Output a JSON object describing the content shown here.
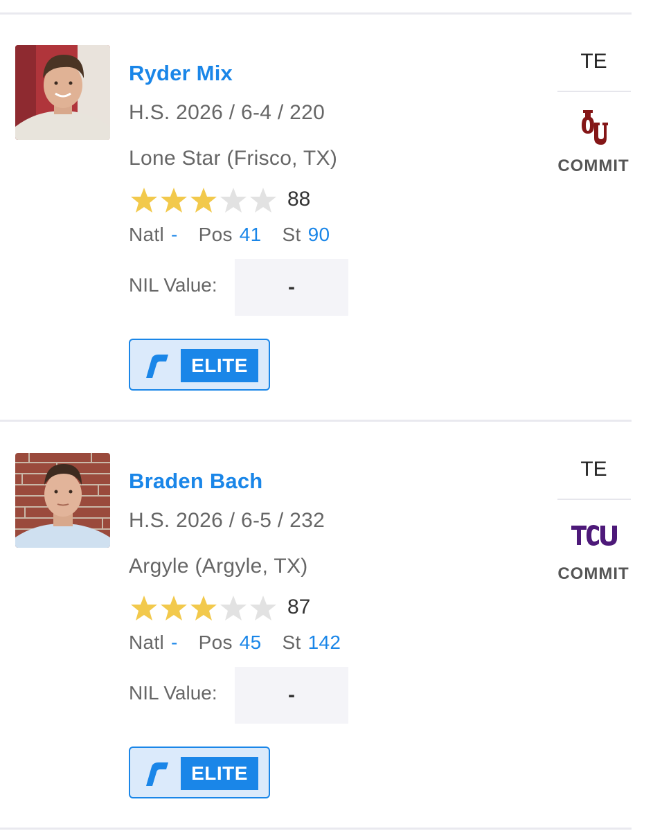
{
  "players": [
    {
      "name": "Ryder Mix",
      "meta": "H.S. 2026 / 6-4 / 220",
      "school": "Lone Star (Frisco, TX)",
      "stars": 3,
      "max_stars": 5,
      "rating": "88",
      "natl_label": "Natl",
      "natl_value": "-",
      "pos_label": "Pos",
      "pos_value": "41",
      "st_label": "St",
      "st_value": "90",
      "nil_label": "NIL Value:",
      "nil_value": "-",
      "badge_label": "ELITE",
      "position": "TE",
      "commit_label": "COMMIT",
      "commit_school_icon": "oklahoma-ou-logo",
      "commit_color": "#841617"
    },
    {
      "name": "Braden Bach",
      "meta": "H.S. 2026 / 6-5 / 232",
      "school": "Argyle (Argyle, TX)",
      "stars": 3,
      "max_stars": 5,
      "rating": "87",
      "natl_label": "Natl",
      "natl_value": "-",
      "pos_label": "Pos",
      "pos_value": "45",
      "st_label": "St",
      "st_value": "142",
      "nil_label": "NIL Value:",
      "nil_value": "-",
      "badge_label": "ELITE",
      "position": "TE",
      "commit_label": "COMMIT",
      "commit_school_icon": "tcu-logo",
      "commit_color": "#4d1979"
    }
  ],
  "colors": {
    "accent": "#1a86e8",
    "star_filled": "#f2c94c",
    "star_empty": "#e2e2e2",
    "badge_bg": "#dbeafb"
  }
}
